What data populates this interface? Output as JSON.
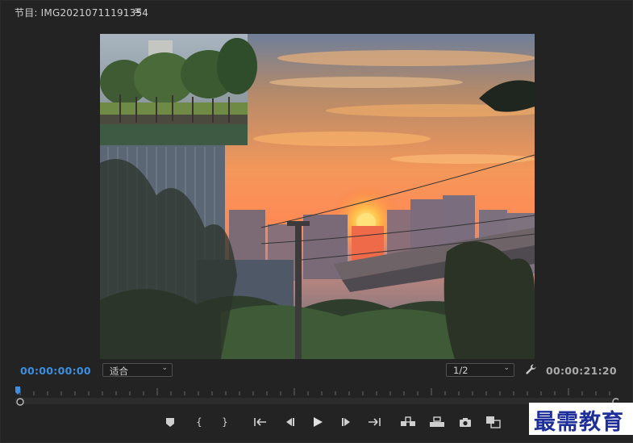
{
  "tab": {
    "title": "节目: IMG20210711191354",
    "menu_glyph": "≡"
  },
  "monitor": {
    "sky_top": "#7d8aa0",
    "sunset": "#ff9a4a",
    "sun": "#ffd25a",
    "pip_caption": ""
  },
  "toolbar": {
    "timecode_current": "00:00:00:00",
    "timecode_duration": "00:00:21:20",
    "zoom": {
      "selected": "适合"
    },
    "resolution": {
      "selected": "1/2"
    },
    "wrench_icon": "wrench-icon"
  },
  "transport": {
    "buttons": [
      {
        "name": "add-marker-button",
        "icon": "marker-icon"
      },
      {
        "name": "mark-in-button",
        "glyph": "{"
      },
      {
        "name": "mark-out-button",
        "glyph": "}"
      },
      {
        "name": "go-to-in-button",
        "glyph": "{←"
      },
      {
        "name": "step-back-button",
        "glyph": "◀|"
      },
      {
        "name": "play-button",
        "glyph": "▶"
      },
      {
        "name": "step-forward-button",
        "glyph": "|▶"
      },
      {
        "name": "go-to-out-button",
        "glyph": "→}"
      },
      {
        "name": "insert-button",
        "icon": "insert-icon"
      },
      {
        "name": "overwrite-button",
        "icon": "overwrite-icon"
      },
      {
        "name": "export-frame-button",
        "icon": "camera-icon"
      },
      {
        "name": "compare-view-button",
        "icon": "compare-icon"
      }
    ]
  },
  "watermark": {
    "text": "最需教育"
  },
  "colors": {
    "accent": "#3c8fe0",
    "panel": "#232323"
  }
}
